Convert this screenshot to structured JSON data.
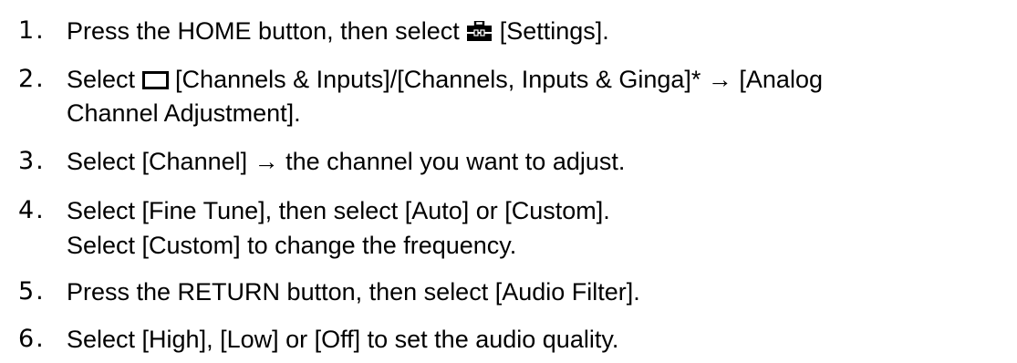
{
  "steps": [
    {
      "number": "1.",
      "lines": [
        {
          "before": "Press the HOME button, then select ",
          "icon": "toolbox-icon",
          "after": " [Settings]."
        }
      ]
    },
    {
      "number": "2.",
      "lines": [
        {
          "before": "Select ",
          "icon": "tv-screen-icon",
          "after": " [Channels & Inputs]/[Channels, Inputs & Ginga]* → [Analog"
        },
        {
          "text": "Channel Adjustment]."
        }
      ]
    },
    {
      "number": "3.",
      "lines": [
        {
          "text": "Select [Channel] → the channel you want to adjust."
        }
      ]
    },
    {
      "number": "4.",
      "lines": [
        {
          "text": "Select [Fine Tune], then select [Auto] or [Custom]."
        },
        {
          "text": "Select [Custom] to change the frequency."
        }
      ]
    },
    {
      "number": "5.",
      "lines": [
        {
          "text": "Press the RETURN button, then select [Audio Filter]."
        }
      ]
    },
    {
      "number": "6.",
      "lines": [
        {
          "text": "Select [High], [Low] or [Off] to set the audio quality."
        }
      ]
    }
  ]
}
